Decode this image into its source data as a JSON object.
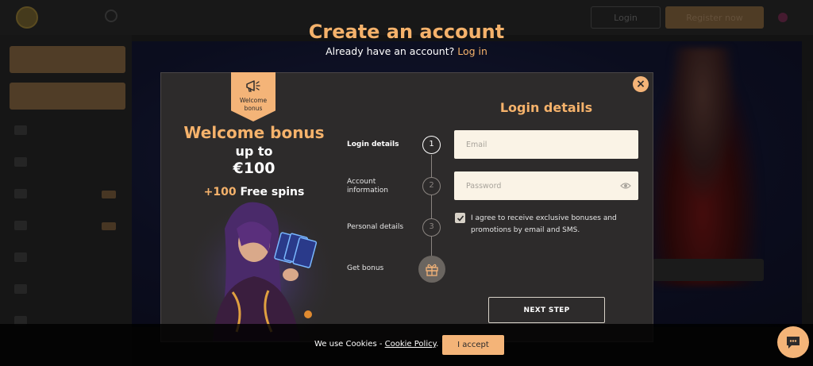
{
  "background_site": {
    "nav_login_label": "Login",
    "nav_register_label": "Register now"
  },
  "header": {
    "title": "Create an account",
    "have_account_text": "Already have an account?",
    "login_link": "Log in"
  },
  "bonus": {
    "ribbon_text": "Welcome bonus",
    "title": "Welcome bonus",
    "up_to": "up to",
    "amount": "€100",
    "spins_amount": "+100",
    "spins_label": "Free spins"
  },
  "steps": [
    {
      "label": "Login details",
      "number": "1",
      "active": true
    },
    {
      "label": "Account information",
      "number": "2",
      "active": false
    },
    {
      "label": "Personal details",
      "number": "3",
      "active": false
    },
    {
      "label": "Get bonus",
      "icon": "gift-icon",
      "active": false
    }
  ],
  "form": {
    "title": "Login details",
    "email_placeholder": "Email",
    "password_placeholder": "Password",
    "agree_checked": true,
    "agree_text": "I agree to receive exclusive bonuses and promotions by email and SMS.",
    "next_button": "NEXT STEP"
  },
  "cookie": {
    "text": "We use Cookies -",
    "link": "Cookie Policy",
    "accept_button": "I accept"
  },
  "colors": {
    "accent": "#f5b26b",
    "modal_bg": "#2d2b2b",
    "input_bg": "#faf3e6"
  },
  "icons": [
    "megaphone-icon",
    "close-icon",
    "gift-icon",
    "eye-icon",
    "check-icon",
    "chat-icon"
  ]
}
